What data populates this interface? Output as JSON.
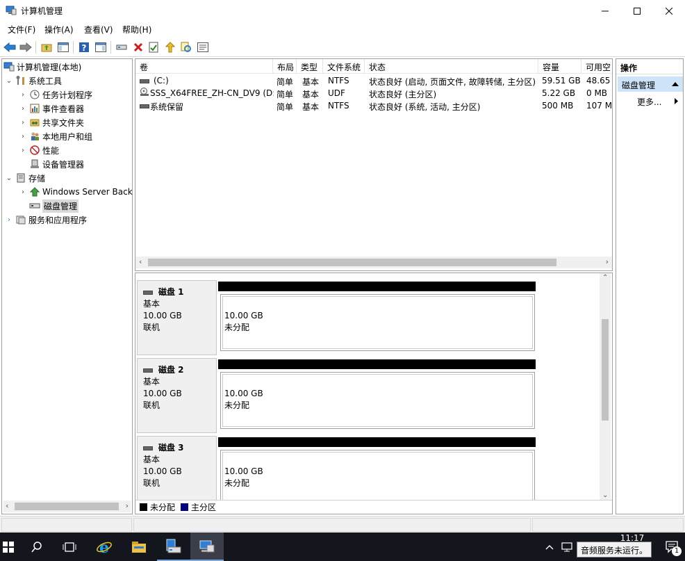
{
  "window": {
    "title": "计算机管理"
  },
  "menu": [
    "文件(F)",
    "操作(A)",
    "查看(V)",
    "帮助(H)"
  ],
  "tree": {
    "root": "计算机管理(本地)",
    "system_tools": "系统工具",
    "task_scheduler": "任务计划程序",
    "event_viewer": "事件查看器",
    "shared_folders": "共享文件夹",
    "local_users": "本地用户和组",
    "performance": "性能",
    "device_manager": "设备管理器",
    "storage": "存储",
    "wsb": "Windows Server Backup",
    "disk_management": "磁盘管理",
    "services_apps": "服务和应用程序"
  },
  "volumes": {
    "columns": [
      "卷",
      "布局",
      "类型",
      "文件系统",
      "状态",
      "容量",
      "可用空"
    ],
    "rows": [
      {
        "name": "(C:)",
        "layout": "简单",
        "type": "基本",
        "fs": "NTFS",
        "status": "状态良好 (启动, 页面文件, 故障转储, 主分区)",
        "capacity": "59.51 GB",
        "free": "48.65"
      },
      {
        "name": "SSS_X64FREE_ZH-CN_DV9 (D:)",
        "layout": "简单",
        "type": "基本",
        "fs": "UDF",
        "status": "状态良好 (主分区)",
        "capacity": "5.22 GB",
        "free": "0 MB"
      },
      {
        "name": "系统保留",
        "layout": "简单",
        "type": "基本",
        "fs": "NTFS",
        "status": "状态良好 (系统, 活动, 主分区)",
        "capacity": "500 MB",
        "free": "107 M"
      }
    ]
  },
  "disks": [
    {
      "name": "磁盘 1",
      "kind": "基本",
      "size": "10.00 GB",
      "state": "联机",
      "part_size": "10.00 GB",
      "part_label": "未分配"
    },
    {
      "name": "磁盘 2",
      "kind": "基本",
      "size": "10.00 GB",
      "state": "联机",
      "part_size": "10.00 GB",
      "part_label": "未分配"
    },
    {
      "name": "磁盘 3",
      "kind": "基本",
      "size": "10.00 GB",
      "state": "联机",
      "part_size": "10.00 GB",
      "part_label": "未分配"
    }
  ],
  "legend": {
    "unallocated": "未分配",
    "primary": "主分区",
    "unallocated_color": "#000000",
    "primary_color": "#000080"
  },
  "actions": {
    "header": "操作",
    "section": "磁盘管理",
    "more": "更多..."
  },
  "taskbar": {
    "time": "11:17",
    "tooltip": "音频服务未运行。",
    "notification_count": "1"
  }
}
